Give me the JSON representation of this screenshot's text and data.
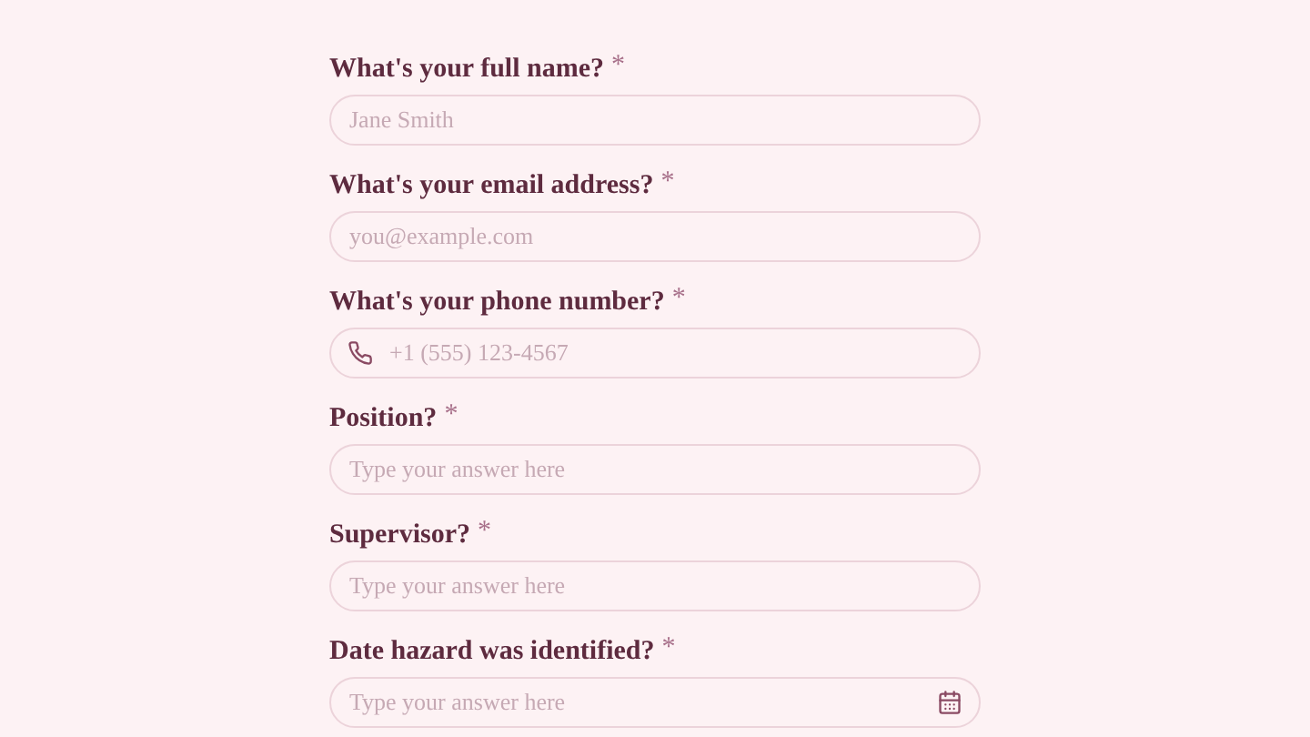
{
  "fields": [
    {
      "label": "What's your full name?",
      "asterisk": "*",
      "kind": "text",
      "placeholder": "Jane Smith"
    },
    {
      "label": "What's your email address?",
      "asterisk": "*",
      "kind": "text",
      "placeholder": "you@example.com"
    },
    {
      "label": "What's your phone number?",
      "asterisk": "*",
      "kind": "phone",
      "placeholder": "+1 (555) 123-4567"
    },
    {
      "label": "Position?",
      "asterisk": "*",
      "kind": "text",
      "placeholder": "Type your answer here"
    },
    {
      "label": "Supervisor?",
      "asterisk": "*",
      "kind": "text",
      "placeholder": "Type your answer here"
    },
    {
      "label": "Date hazard was identified?",
      "asterisk": "*",
      "kind": "date",
      "placeholder": "Type your answer here"
    }
  ]
}
